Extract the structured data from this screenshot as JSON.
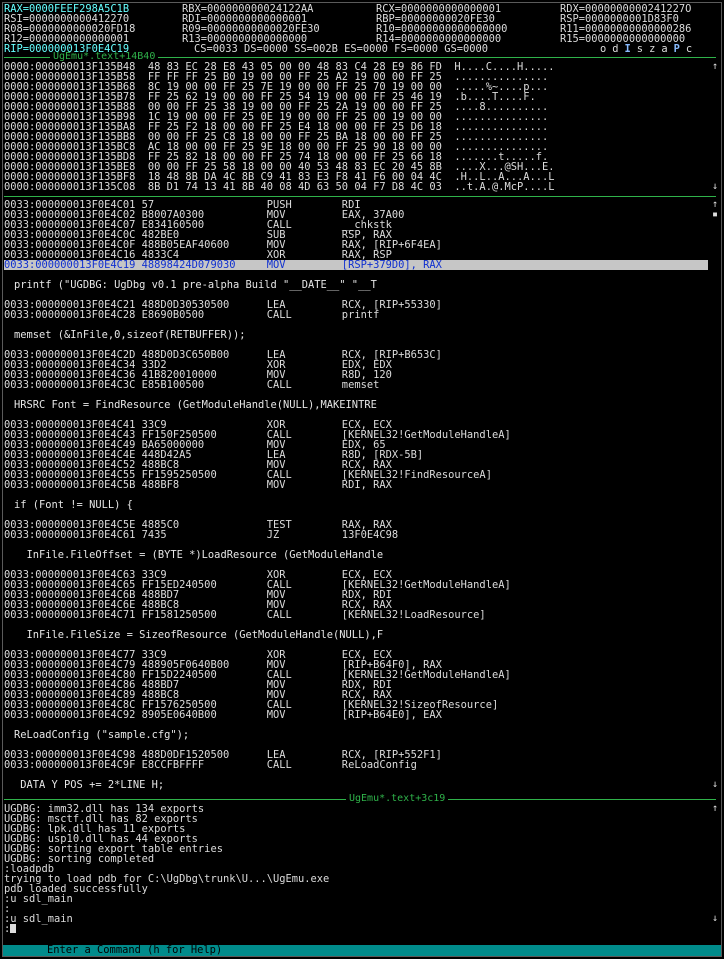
{
  "registers": {
    "row1": [
      {
        "text": "RAX=0000FEEF298A5C1B",
        "changed": true
      },
      {
        "text": "RBX=000000000024122AA",
        "changed": false
      },
      {
        "text": "RCX=0000000000000001",
        "changed": false
      },
      {
        "text": "RDX=0000000000241227O",
        "changed": false
      }
    ],
    "row2": [
      {
        "text": "RSI=0000000000412270",
        "changed": false
      },
      {
        "text": "RDI=0000000000000001",
        "changed": false
      },
      {
        "text": "RBP=00000000020FE30",
        "changed": false
      },
      {
        "text": "RSP=0000000001D83F0",
        "changed": false
      }
    ],
    "row3": [
      {
        "text": "R08=0000000000020FD18",
        "changed": false
      },
      {
        "text": "R09=00000000000020FE30",
        "changed": false
      },
      {
        "text": "R10=00000000000000000",
        "changed": false
      },
      {
        "text": "R11=00000000000000286",
        "changed": false
      }
    ],
    "row4": [
      {
        "text": "R12=0000000000000001",
        "changed": false
      },
      {
        "text": "R13=0000000000000000",
        "changed": false
      },
      {
        "text": "R14=0000000000000000",
        "changed": false
      },
      {
        "text": "R15=0000000000000000",
        "changed": false
      }
    ],
    "row5": {
      "rip": "RIP=000000013F0E4C19",
      "segs": "CS=0033 DS=0000 SS=002B ES=0000 FS=0000 GS=0000",
      "flags": [
        {
          "ch": "o",
          "set": false
        },
        {
          "ch": "d",
          "set": false
        },
        {
          "ch": "I",
          "set": true
        },
        {
          "ch": "s",
          "set": false
        },
        {
          "ch": "z",
          "set": false
        },
        {
          "ch": "a",
          "set": false
        },
        {
          "ch": "P",
          "set": true
        },
        {
          "ch": "c",
          "set": false
        }
      ]
    }
  },
  "separators": {
    "data": "UgEmu*.text+14B40",
    "code_end": "UgEmu*.text+3c19"
  },
  "data_dump": [
    "0000:000000013F135B48  48 83 EC 28 E8 43 05 00 00 48 83 C4 28 E9 86 FD  H....C....H.....",
    "0000:000000013F135B58  FF FF FF 25 B0 19 00 00 FF 25 A2 19 00 00 FF 25  ...............",
    "0000:000000013F135B68  8C 19 00 00 FF 25 7E 19 00 00 FF 25 70 19 00 00  .....%~....p...",
    "0000:000000013F135B78  FF 25 62 19 00 00 FF 25 54 19 00 00 FF 25 46 19  .b....T....F.",
    "0000:000000013F135B88  00 00 FF 25 38 19 00 00 FF 25 2A 19 00 00 FF 25  ....8..........",
    "0000:000000013F135B98  1C 19 00 00 FF 25 0E 19 00 00 FF 25 00 19 00 00  ...............",
    "0000:000000013F135BA8  FF 25 F2 18 00 00 FF 25 E4 18 00 00 FF 25 D6 18  ...............",
    "0000:000000013F135BB8  00 00 FF 25 C8 18 00 00 FF 25 BA 18 00 00 FF 25  ...............",
    "0000:000000013F135BC8  AC 18 00 00 FF 25 9E 18 00 00 FF 25 90 18 00 00  ...............",
    "0000:000000013F135BD8  FF 25 82 18 00 00 FF 25 74 18 00 00 FF 25 66 18  .......t.....f.",
    "0000:000000013F135BE8  00 00 FF 25 58 18 00 00 40 53 48 83 EC 20 45 8B  ....X...@SH...E.",
    "0000:000000013F135BF8  18 48 8B DA 4C 8B C9 41 83 E3 F8 41 F6 00 04 4C  .H..L..A...A...L",
    "0000:000000013F135C08  8B D1 74 13 41 8B 40 08 4D 63 50 04 F7 D8 4C 03  ..t.A.@.McP....L"
  ],
  "code": [
    {
      "kind": "asm",
      "text": "0033:000000013F0E4C01 57                  PUSH        RDI"
    },
    {
      "kind": "asm",
      "text": "0033:000000013F0E4C02 B8007A0300          MOV         EAX, 37A00"
    },
    {
      "kind": "asm",
      "text": "0033:000000013F0E4C07 E834160500          CALL        __chkstk"
    },
    {
      "kind": "asm",
      "text": "0033:000000013F0E4C0C 482BE0              SUB         RSP, RAX"
    },
    {
      "kind": "asm",
      "text": "0033:000000013F0E4C0F 488B05EAF40600      MOV         RAX, [RIP+6F4EA]"
    },
    {
      "kind": "asm",
      "text": "0033:000000013F0E4C16 4833C4              XOR         RAX, RSP"
    },
    {
      "kind": "cur",
      "text": "0033:000000013F0E4C19 48898424D079030     MOV         [RSP+379D0], RAX"
    },
    {
      "kind": "blank",
      "text": ""
    },
    {
      "kind": "src",
      "text": "printf (\"UGDBG: UgDbg v0.1 pre-alpha Build \"__DATE__\" \"__T"
    },
    {
      "kind": "blank",
      "text": ""
    },
    {
      "kind": "asm",
      "text": "0033:000000013F0E4C21 488D0D30530500      LEA         RCX, [RIP+55330]"
    },
    {
      "kind": "asm",
      "text": "0033:000000013F0E4C28 E8690B0500          CALL        printf"
    },
    {
      "kind": "blank",
      "text": ""
    },
    {
      "kind": "src",
      "text": "memset (&InFile,0,sizeof(RETBUFFER));"
    },
    {
      "kind": "blank",
      "text": ""
    },
    {
      "kind": "asm",
      "text": "0033:000000013F0E4C2D 488D0D3C650B00      LEA         RCX, [RIP+B653C]"
    },
    {
      "kind": "asm",
      "text": "0033:000000013F0E4C34 33D2                XOR         EDX, EDX"
    },
    {
      "kind": "asm",
      "text": "0033:000000013F0E4C36 41B820010000        MOV         R8D, 120"
    },
    {
      "kind": "asm",
      "text": "0033:000000013F0E4C3C E85B100500          CALL        memset"
    },
    {
      "kind": "blank",
      "text": ""
    },
    {
      "kind": "src",
      "text": "HRSRC Font = FindResource (GetModuleHandle(NULL),MAKEINTRE"
    },
    {
      "kind": "blank",
      "text": ""
    },
    {
      "kind": "asm",
      "text": "0033:000000013F0E4C41 33C9                XOR         ECX, ECX"
    },
    {
      "kind": "asm",
      "text": "0033:000000013F0E4C43 FF150F250500        CALL        [KERNEL32!GetModuleHandleA]"
    },
    {
      "kind": "asm",
      "text": "0033:000000013F0E4C49 BA65000000          MOV         EDX, 65"
    },
    {
      "kind": "asm",
      "text": "0033:000000013F0E4C4E 448D42A5            LEA         R8D, [RDX-5B]"
    },
    {
      "kind": "asm",
      "text": "0033:000000013F0E4C52 488BC8              MOV         RCX, RAX"
    },
    {
      "kind": "asm",
      "text": "0033:000000013F0E4C55 FF1595250500        CALL        [KERNEL32!FindResourceA]"
    },
    {
      "kind": "asm",
      "text": "0033:000000013F0E4C5B 488BF8              MOV         RDI, RAX"
    },
    {
      "kind": "blank",
      "text": ""
    },
    {
      "kind": "src",
      "text": "if (Font != NULL) {"
    },
    {
      "kind": "blank",
      "text": ""
    },
    {
      "kind": "asm",
      "text": "0033:000000013F0E4C5E 4885C0              TEST        RAX, RAX"
    },
    {
      "kind": "asm",
      "text": "0033:000000013F0E4C61 7435                JZ          13F0E4C98"
    },
    {
      "kind": "blank",
      "text": ""
    },
    {
      "kind": "src",
      "text": "  InFile.FileOffset = (BYTE *)LoadResource (GetModuleHandle"
    },
    {
      "kind": "blank",
      "text": ""
    },
    {
      "kind": "asm",
      "text": "0033:000000013F0E4C63 33C9                XOR         ECX, ECX"
    },
    {
      "kind": "asm",
      "text": "0033:000000013F0E4C65 FF15ED240500        CALL        [KERNEL32!GetModuleHandleA]"
    },
    {
      "kind": "asm",
      "text": "0033:000000013F0E4C6B 488BD7              MOV         RDX, RDI"
    },
    {
      "kind": "asm",
      "text": "0033:000000013F0E4C6E 488BC8              MOV         RCX, RAX"
    },
    {
      "kind": "asm",
      "text": "0033:000000013F0E4C71 FF1581250500        CALL        [KERNEL32!LoadResource]"
    },
    {
      "kind": "blank",
      "text": ""
    },
    {
      "kind": "src",
      "text": "  InFile.FileSize = SizeofResource (GetModuleHandle(NULL),F"
    },
    {
      "kind": "blank",
      "text": ""
    },
    {
      "kind": "asm",
      "text": "0033:000000013F0E4C77 33C9                XOR         ECX, ECX"
    },
    {
      "kind": "asm",
      "text": "0033:000000013F0E4C79 488905F0640B00      MOV         [RIP+B64F0], RAX"
    },
    {
      "kind": "asm",
      "text": "0033:000000013F0E4C80 FF15D2240500        CALL        [KERNEL32!GetModuleHandleA]"
    },
    {
      "kind": "asm",
      "text": "0033:000000013F0E4C86 488BD7              MOV         RDX, RDI"
    },
    {
      "kind": "asm",
      "text": "0033:000000013F0E4C89 488BC8              MOV         RCX, RAX"
    },
    {
      "kind": "asm",
      "text": "0033:000000013F0E4C8C FF1576250500        CALL        [KERNEL32!SizeofResource]"
    },
    {
      "kind": "asm",
      "text": "0033:000000013F0E4C92 8905E0640B00        MOV         [RIP+B64E0], EAX"
    },
    {
      "kind": "blank",
      "text": ""
    },
    {
      "kind": "src",
      "text": "ReLoadConfig (\"sample.cfg\");"
    },
    {
      "kind": "blank",
      "text": ""
    },
    {
      "kind": "asm",
      "text": "0033:000000013F0E4C98 488D0DF1520500      LEA         RCX, [RIP+552F1]"
    },
    {
      "kind": "asm",
      "text": "0033:000000013F0E4C9F E8CCFBFFFF          CALL        ReLoadConfig"
    },
    {
      "kind": "blank",
      "text": ""
    },
    {
      "kind": "src",
      "text": " DATA_Y_POS += 2*LINE_H;"
    }
  ],
  "console": [
    "UGDBG: imm32.dll has 134 exports",
    "UGDBG: msctf.dll has 82 exports",
    "UGDBG: lpk.dll has 11 exports",
    "UGDBG: usp10.dll has 44 exports",
    "UGDBG: sorting export table entries",
    "UGDBG: sorting completed",
    ":loadpdb",
    "trying to load pdb for C:\\UgDbg\\trunk\\U...\\UgEmu.exe",
    "pdb loaded successfully",
    ":u sdl_main",
    ":",
    ":u sdl_main",
    ":"
  ],
  "command_hint": "Enter a Command (h for Help)"
}
